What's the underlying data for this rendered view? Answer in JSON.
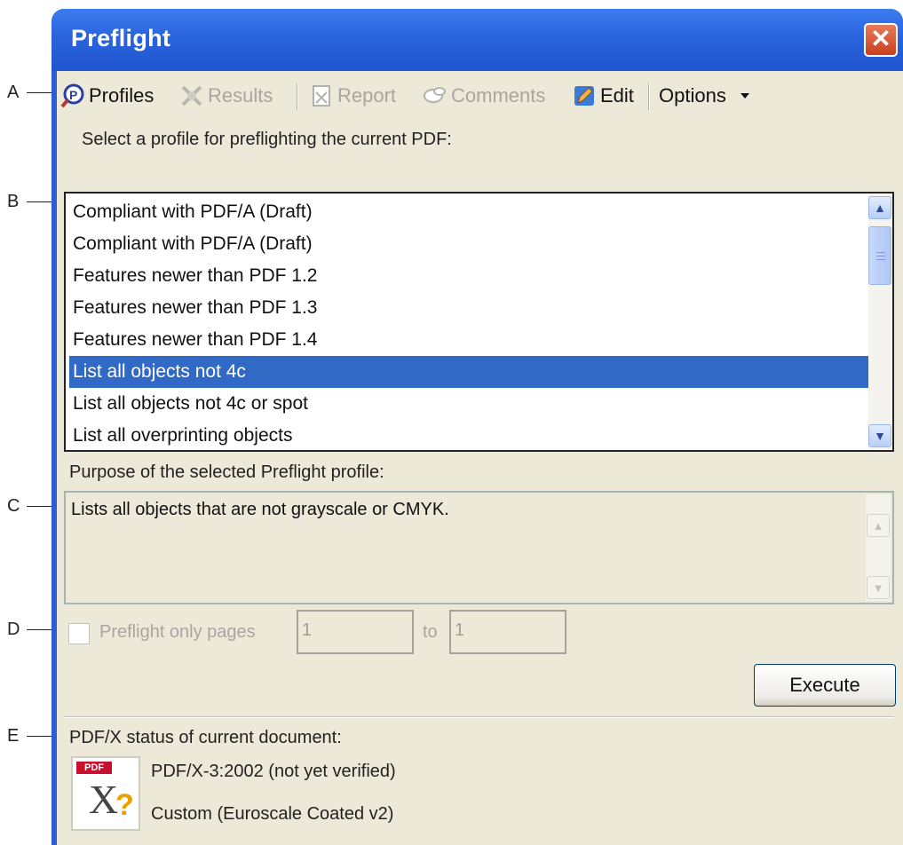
{
  "callouts": [
    "A",
    "B",
    "C",
    "D",
    "E"
  ],
  "window": {
    "title": "Preflight",
    "close_icon": "close-icon"
  },
  "toolbar": {
    "profiles": "Profiles",
    "results": "Results",
    "report": "Report",
    "comments": "Comments",
    "edit": "Edit",
    "options": "Options"
  },
  "prompt": "Select a profile for preflighting the current PDF:",
  "profiles": [
    "Compliant with PDF/A (Draft)",
    "Compliant with PDF/A (Draft)",
    "Features newer than PDF 1.2",
    "Features newer than PDF 1.3",
    "Features newer than PDF 1.4",
    "List all objects not 4c",
    "List all objects not 4c or spot",
    "List all overprinting objects"
  ],
  "selected_profile": "List all objects not 4c",
  "purpose_label": "Purpose of the selected Preflight profile:",
  "purpose_text": "Lists all objects that are not grayscale or CMYK.",
  "page_range": {
    "checkbox_label": "Preflight only pages",
    "from": "1",
    "to_label": "to",
    "to": "1",
    "checked": false
  },
  "execute_label": "Execute",
  "pdfx": {
    "label": "PDF/X status of current document:",
    "icon_tag": "PDF",
    "status": "PDF/X-3:2002 (not yet verified)",
    "output": "Custom (Euroscale Coated v2)"
  },
  "colors": {
    "titlebar": "#2a64dd",
    "selection": "#316ac5",
    "face": "#ece9d8"
  }
}
